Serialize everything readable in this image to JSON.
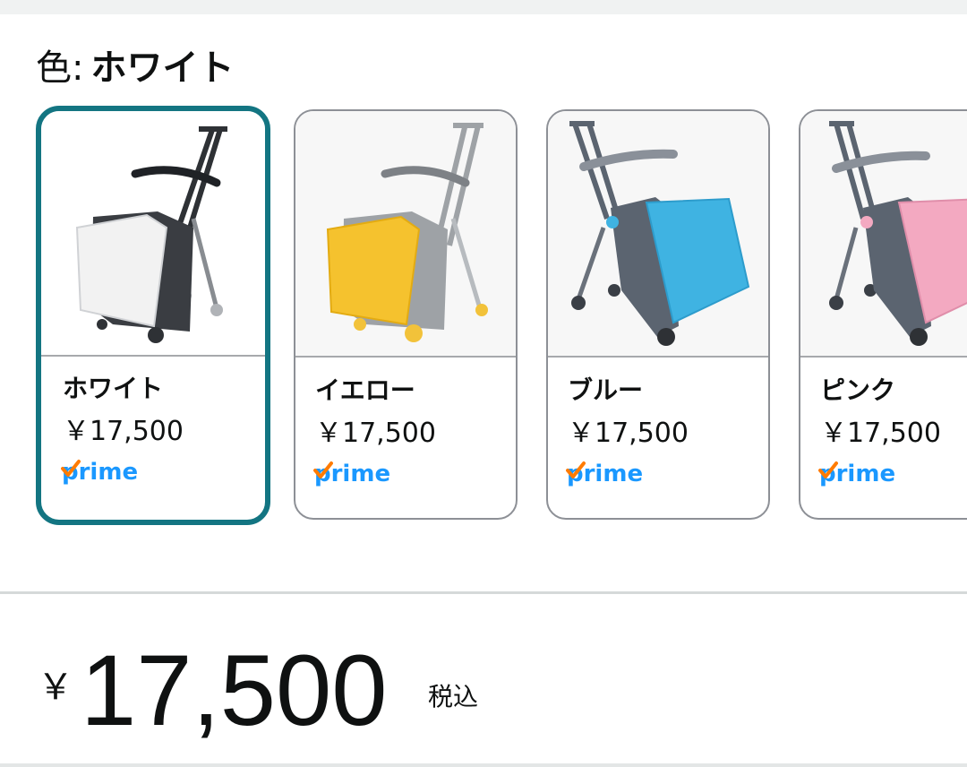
{
  "color_selector": {
    "label_prefix": "色:",
    "selected_value": "ホワイト"
  },
  "swatches": [
    {
      "name": "ホワイト",
      "price": "￥17,500",
      "prime": "prime",
      "selected": true,
      "case_color": "#f2f2f2",
      "body_color": "#3a3d42"
    },
    {
      "name": "イエロー",
      "price": "￥17,500",
      "prime": "prime",
      "selected": false,
      "case_color": "#f5c22e",
      "body_color": "#9ea2a6"
    },
    {
      "name": "ブルー",
      "price": "￥17,500",
      "prime": "prime",
      "selected": false,
      "case_color": "#3fb3e2",
      "body_color": "#5b6470"
    },
    {
      "name": "ピンク",
      "price": "￥17,500",
      "prime": "prime",
      "selected": false,
      "case_color": "#f3a9c1",
      "body_color": "#5b6470"
    }
  ],
  "price": {
    "currency": "￥",
    "amount": "17,500",
    "tax_label": "税込"
  },
  "colors": {
    "selected_border": "#137582",
    "prime_blue": "#1a98ff",
    "prime_check": "#ff7b00"
  }
}
